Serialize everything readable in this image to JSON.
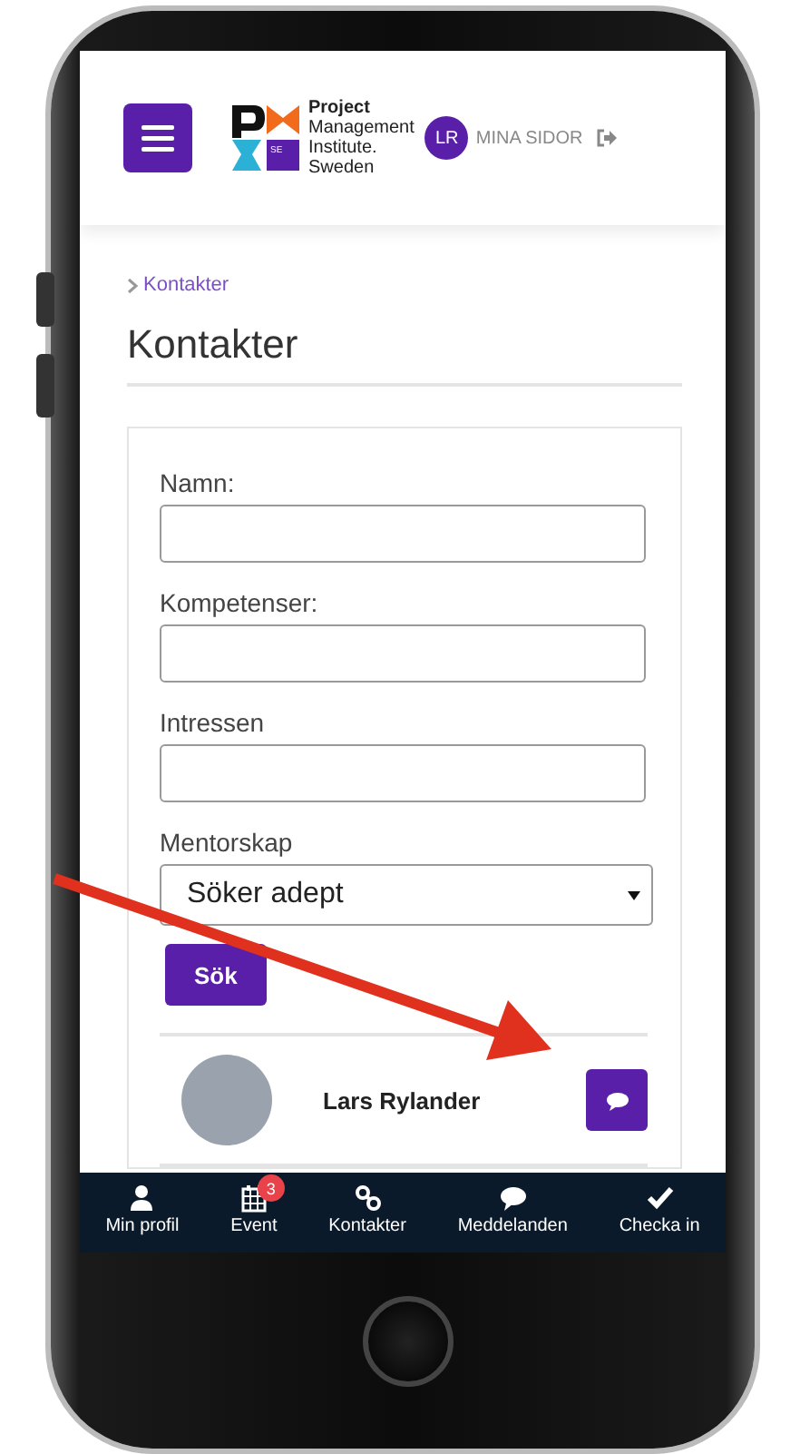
{
  "header": {
    "logo_lines": [
      "Project",
      "Management",
      "Institute.",
      "Sweden"
    ],
    "logo_badge": "SE",
    "avatar_initials": "LR",
    "account_link": "MINA SIDOR"
  },
  "breadcrumb": {
    "label": "Kontakter"
  },
  "title": "Kontakter",
  "search_form": {
    "fields": [
      {
        "kind": "text",
        "label": "Namn:"
      },
      {
        "kind": "text",
        "label": "Kompetenser:"
      },
      {
        "kind": "text",
        "label": "Intressen"
      },
      {
        "kind": "select",
        "label": "Mentorskap",
        "value": "Söker adept"
      }
    ],
    "submit": "Sök"
  },
  "contacts": [
    {
      "name": "Lars Rylander"
    }
  ],
  "bottom_nav": [
    {
      "kind": "profile",
      "label": "Min profil"
    },
    {
      "kind": "calendar",
      "label": "Event",
      "badge": "3"
    },
    {
      "kind": "link",
      "label": "Kontakter"
    },
    {
      "kind": "chat",
      "label": "Meddelanden"
    },
    {
      "kind": "check",
      "label": "Checka in"
    }
  ]
}
